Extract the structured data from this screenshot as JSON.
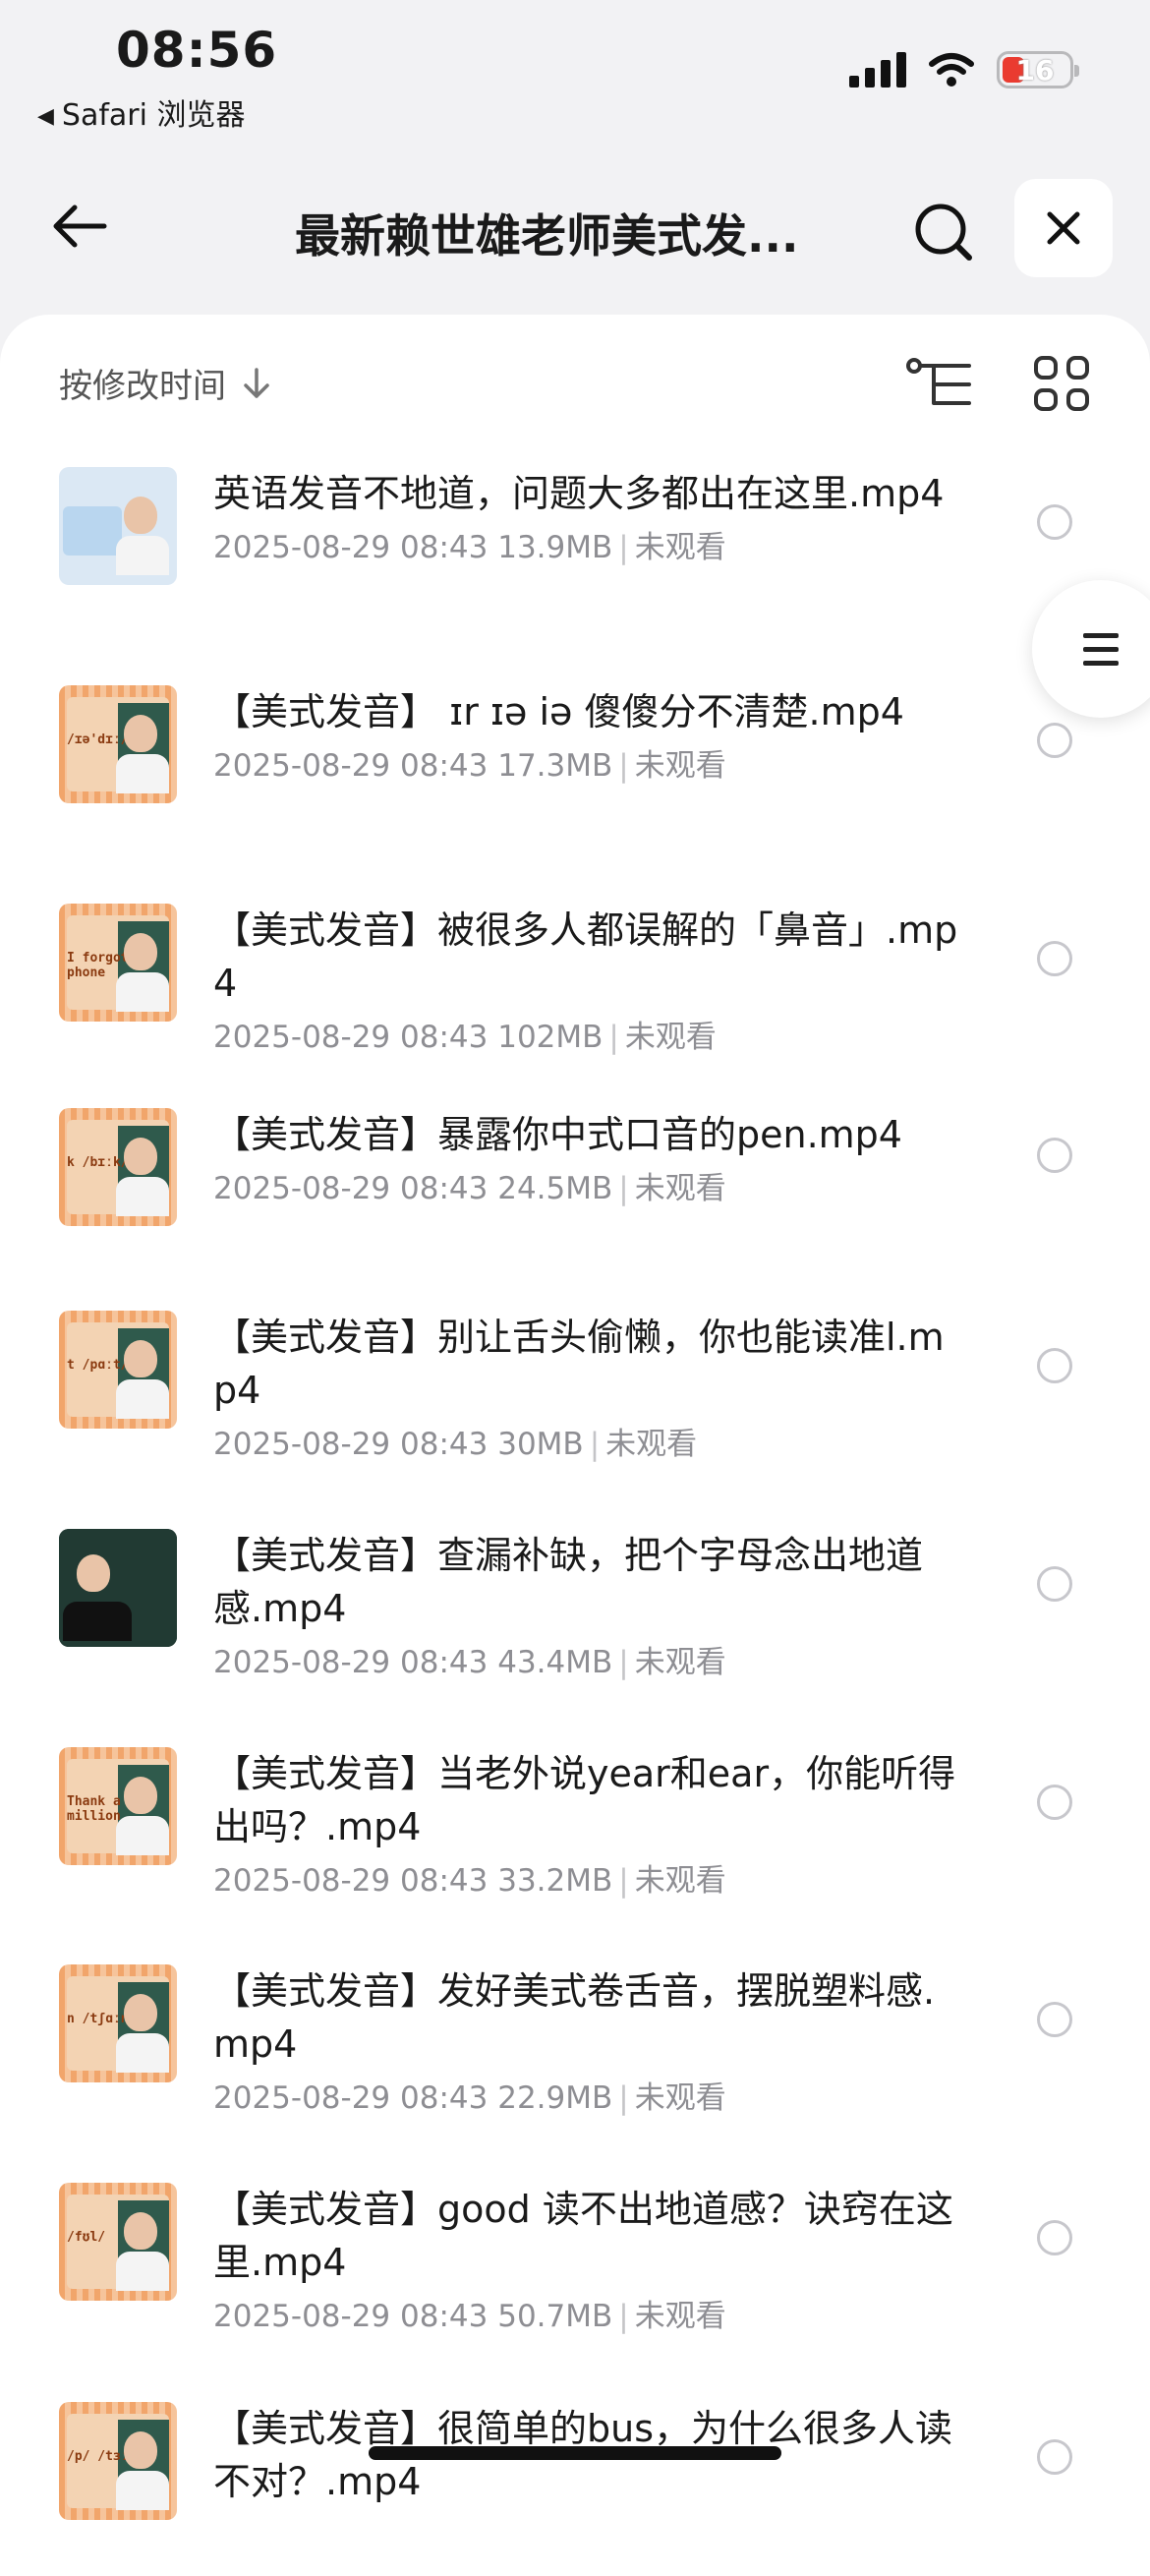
{
  "status_bar": {
    "time": "08:56",
    "back_app": "Safari 浏览器",
    "battery": "16"
  },
  "header": {
    "title": "最新赖世雄老师美式发...",
    "icons": [
      "back-arrow-icon",
      "search-icon",
      "close-icon"
    ]
  },
  "sort": {
    "label": "按修改时间"
  },
  "files": [
    {
      "name": "英语发音不地道，问题大多都出在这里.mp4",
      "date": "2025-08-29 08:43",
      "size": "13.9MB",
      "status": "未观看"
    },
    {
      "name": "【美式发音】 ɪr   ɪə   iə  傻傻分不清楚.mp4",
      "date": "2025-08-29 08:43",
      "size": "17.3MB",
      "status": "未观看"
    },
    {
      "name": "【美式发音】被很多人都误解的「鼻音」.mp4",
      "date": "2025-08-29 08:43",
      "size": "102MB",
      "status": "未观看"
    },
    {
      "name": "【美式发音】暴露你中式口音的pen.mp4",
      "date": "2025-08-29 08:43",
      "size": "24.5MB",
      "status": "未观看"
    },
    {
      "name": "【美式发音】别让舌头偷懒，你也能读准l.mp4",
      "date": "2025-08-29 08:43",
      "size": "30MB",
      "status": "未观看"
    },
    {
      "name": "【美式发音】查漏补缺，把个字母念出地道感.mp4",
      "date": "2025-08-29 08:43",
      "size": "43.4MB",
      "status": "未观看"
    },
    {
      "name": "【美式发音】当老外说year和ear，你能听得出吗？.mp4",
      "date": "2025-08-29 08:43",
      "size": "33.2MB",
      "status": "未观看"
    },
    {
      "name": "【美式发音】发好美式卷舌音，摆脱塑料感.mp4",
      "date": "2025-08-29 08:43",
      "size": "22.9MB",
      "status": "未观看"
    },
    {
      "name": "【美式发音】good 读不出地道感？诀窍在这里.mp4",
      "date": "2025-08-29 08:43",
      "size": "50.7MB",
      "status": "未观看"
    },
    {
      "name": "【美式发音】很简单的bus，为什么很多人读不对？.mp4",
      "date": "",
      "size": "",
      "status": ""
    }
  ],
  "thumb_labels": [
    "",
    "/ɪə'dɪː/",
    "I forgot my phone",
    "k /bɪːk/",
    "t /pɑːt/",
    "",
    "Thank a million",
    "n /tʃɑːn/",
    "/fʊl/",
    "/p/ /tɜːt/"
  ]
}
